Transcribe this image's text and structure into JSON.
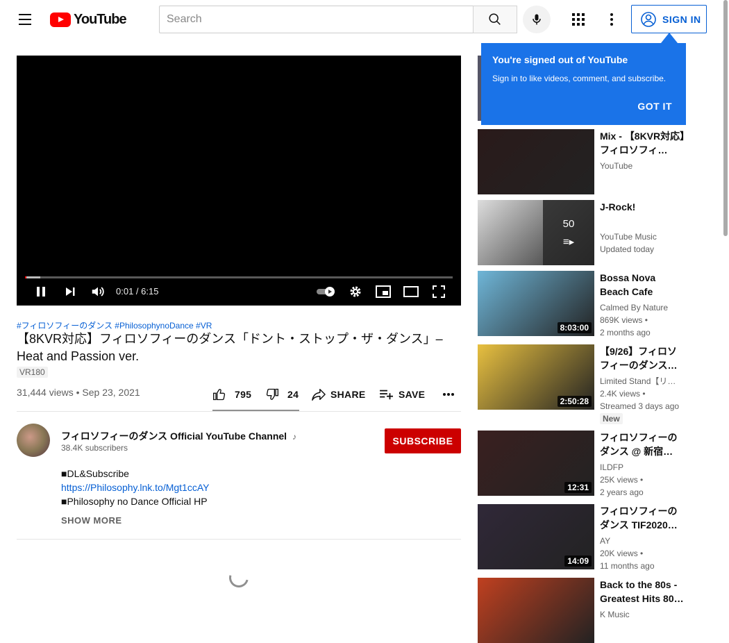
{
  "header": {
    "logo_text": "YouTube",
    "search_placeholder": "Search",
    "signin_label": "SIGN IN"
  },
  "player": {
    "time": "0:01 / 6:15",
    "progress_fraction": 0.003,
    "loaded_fraction": 0.035
  },
  "video": {
    "hashtags": "#フィロソフィーのダンス #PhilosophynoDance #VR",
    "title": "【8KVR対応】フィロソフィーのダンス「ドント・ストップ・ザ・ダンス」– Heat and Passion ver.",
    "badge": "VR180",
    "views": "31,444 views • Sep 23, 2021",
    "likes": "795",
    "dislikes": "24",
    "share_label": "SHARE",
    "save_label": "SAVE"
  },
  "channel": {
    "name": "フィロソフィーのダンス Official YouTube Channel",
    "subscribers": "38.4K subscribers",
    "subscribe_label": "SUBSCRIBE"
  },
  "description": {
    "line1": "■DL&Subscribe",
    "link": "https://Philosophy.lnk.to/Mgt1ccAY",
    "line3": "■Philosophy no Dance Official HP",
    "show_more": "SHOW MORE"
  },
  "popup": {
    "title": "You're signed out of YouTube",
    "text": "Sign in to like videos, comment, and subscribe.",
    "button": "GOT IT"
  },
  "recommendations": [
    {
      "title": "Mix - 【8KVR対応】フィロソフィ…",
      "meta": [
        "YouTube"
      ],
      "duration": "",
      "thumb_color": "#2a1a1a"
    },
    {
      "title": "J-Rock!",
      "meta": [
        "YouTube Music",
        "Updated today"
      ],
      "duration": "",
      "playlist_count": "50",
      "thumb_color": "#ddd"
    },
    {
      "title": "Bossa Nova Beach Cafe Ambience…",
      "meta": [
        "Calmed By Nature",
        "869K views •",
        "2 months ago"
      ],
      "duration": "8:03:00",
      "thumb_color": "#6fb6d8"
    },
    {
      "title": "【9/26】フィロソフィーのダンス…",
      "meta": [
        "Limited Stand【リ…",
        "2.4K views •",
        "Streamed 3 days ago"
      ],
      "duration": "2:50:28",
      "badge": "New",
      "thumb_color": "#e8c040"
    },
    {
      "title": "フィロソフィーのダンス @ 新宿…",
      "meta": [
        "ILDFP",
        "25K views •",
        "2 years ago"
      ],
      "duration": "12:31",
      "thumb_color": "#3a2020"
    },
    {
      "title": "フィロソフィーのダンス TIF2020…",
      "meta": [
        "AY",
        "20K views •",
        "11 months ago"
      ],
      "duration": "14:09",
      "thumb_color": "#302838"
    },
    {
      "title": "Back to the 80s - Greatest Hits 80…",
      "meta": [
        "K Music"
      ],
      "duration": "",
      "thumb_color": "#c04020"
    }
  ]
}
